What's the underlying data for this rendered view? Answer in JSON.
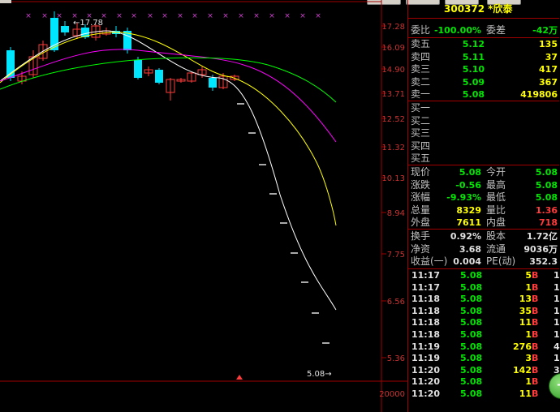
{
  "stock": {
    "code_name": "300372 *欣泰"
  },
  "chart": {
    "price_labels": [
      "17.28",
      "16.09",
      "14.90",
      "13.71",
      "12.52",
      "11.32",
      "10.13",
      "8.94",
      "7.75",
      "6.56",
      "5.36"
    ],
    "volume_label": "20000",
    "high_marker": "17.78",
    "last_marker": "5.08"
  },
  "quote": {
    "weibi_label": "委比",
    "weibi_value": "-100.00%",
    "weicha_label": "委差",
    "weicha_value": "-42万",
    "asks": [
      {
        "label": "卖五",
        "price": "5.12",
        "vol": "135"
      },
      {
        "label": "卖四",
        "price": "5.11",
        "vol": "37"
      },
      {
        "label": "卖三",
        "price": "5.10",
        "vol": "417"
      },
      {
        "label": "卖二",
        "price": "5.09",
        "vol": "367"
      },
      {
        "label": "卖一",
        "price": "5.08",
        "vol": "419806"
      }
    ],
    "bids": [
      {
        "label": "买一"
      },
      {
        "label": "买二"
      },
      {
        "label": "买三"
      },
      {
        "label": "买四"
      },
      {
        "label": "买五"
      }
    ],
    "stats": [
      {
        "l1": "现价",
        "v1": "5.08",
        "l2": "今开",
        "v2": "5.08"
      },
      {
        "l1": "涨跌",
        "v1": "-0.56",
        "l2": "最高",
        "v2": "5.08"
      },
      {
        "l1": "涨幅",
        "v1": "-9.93%",
        "l2": "最低",
        "v2": "5.08"
      },
      {
        "l1": "总量",
        "v1": "8329",
        "l2": "量比",
        "v2": "1.36"
      },
      {
        "l1": "外盘",
        "v1": "7611",
        "l2": "内盘",
        "v2": "718"
      }
    ],
    "info": [
      {
        "l1": "换手",
        "v1": "0.92%",
        "l2": "股本",
        "v2": "1.72亿"
      },
      {
        "l1": "净资",
        "v1": "3.68",
        "l2": "流通",
        "v2": "9036万"
      },
      {
        "l1": "收益(一)",
        "v1": "0.004",
        "l2": "PE(动)",
        "v2": "352.3"
      }
    ]
  },
  "ticks": [
    {
      "time": "11:17",
      "price": "5.08",
      "vol": "5",
      "bs": "B",
      "n": "1"
    },
    {
      "time": "11:17",
      "price": "5.08",
      "vol": "1",
      "bs": "B",
      "n": "1"
    },
    {
      "time": "11:18",
      "price": "5.08",
      "vol": "13",
      "bs": "B",
      "n": "1"
    },
    {
      "time": "11:18",
      "price": "5.08",
      "vol": "35",
      "bs": "B",
      "n": "1"
    },
    {
      "time": "11:18",
      "price": "5.08",
      "vol": "11",
      "bs": "B",
      "n": "1"
    },
    {
      "time": "11:18",
      "price": "5.08",
      "vol": "1",
      "bs": "B",
      "n": "1"
    },
    {
      "time": "11:19",
      "price": "5.08",
      "vol": "276",
      "bs": "B",
      "n": "4"
    },
    {
      "time": "11:19",
      "price": "5.08",
      "vol": "3",
      "bs": "B",
      "n": "1"
    },
    {
      "time": "11:20",
      "price": "5.08",
      "vol": "142",
      "bs": "B",
      "n": "3"
    },
    {
      "time": "11:20",
      "price": "5.08",
      "vol": "1",
      "bs": "B",
      "n": "1"
    },
    {
      "time": "11:20",
      "price": "5.08",
      "vol": "11",
      "bs": "B",
      "n": "2"
    }
  ],
  "colors": {
    "up": "#ff3b3b",
    "down": "#00e6ff",
    "ma5": "#ffffff",
    "ma10": "#ffff00",
    "ma20": "#ff00ff",
    "ma60": "#00ff00",
    "axis": "#a00000"
  }
}
